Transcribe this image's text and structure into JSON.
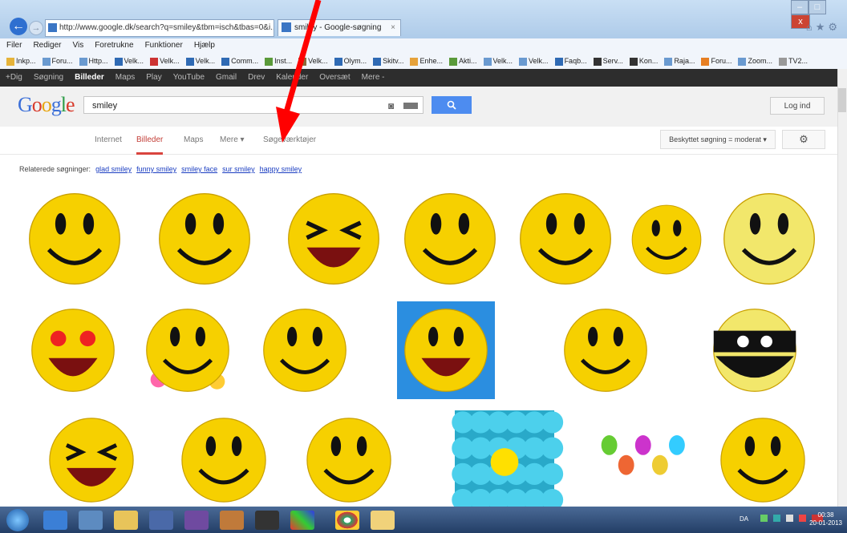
{
  "browser": {
    "address": "http://www.google.dk/search?q=smiley&tbm=isch&tbas=0&i...",
    "tab_title": "smiley - Google-søgning",
    "tab_close": "×",
    "back_glyph": "←",
    "forward_glyph": "→"
  },
  "menu": [
    "Filer",
    "Rediger",
    "Vis",
    "Foretrukne",
    "Funktioner",
    "Hjælp"
  ],
  "favorites": [
    "Inkp...",
    "Foru...",
    "Http...",
    "Velk...",
    "Velk...",
    "Velk...",
    "Comm...",
    "Inst...",
    "Velk...",
    "Olym...",
    "Skitv...",
    "Enhe...",
    "Akti...",
    "Velk...",
    "Velk...",
    "Faqb...",
    "Serv...",
    "Kon...",
    "Raja...",
    "Foru...",
    "Zoom...",
    "TV2..."
  ],
  "gbar": {
    "items": [
      "+Dig",
      "Søgning",
      "Billeder",
      "Maps",
      "Play",
      "YouTube",
      "Gmail",
      "Drev",
      "Kalender",
      "Oversæt",
      "Mere -"
    ],
    "active_index": 2
  },
  "search": {
    "logo": "Google",
    "query": "smiley",
    "login_label": "Log ind"
  },
  "tabs": {
    "items": [
      "Internet",
      "Billeder",
      "Maps",
      "Mere ▾",
      "Søgeværktøjer"
    ],
    "active_index": 1,
    "safe_search": "Beskyttet søgning = moderat ▾",
    "gear_glyph": "⚙"
  },
  "related": {
    "label": "Relaterede søgninger:",
    "links": [
      "glad smiley",
      "funny smiley",
      "smiley face",
      "sur smiley",
      "happy smiley"
    ]
  },
  "taskbar": {
    "clock_time": "00:38",
    "clock_date": "20-01-2013",
    "tray_lang": "DA"
  },
  "colors": {
    "accent_blue": "#4d8cf0",
    "active_tab": "#d9443e",
    "link": "#1a3dc1",
    "smiley_yellow": "#f6d000",
    "annotation_arrow": "#ff0000"
  }
}
